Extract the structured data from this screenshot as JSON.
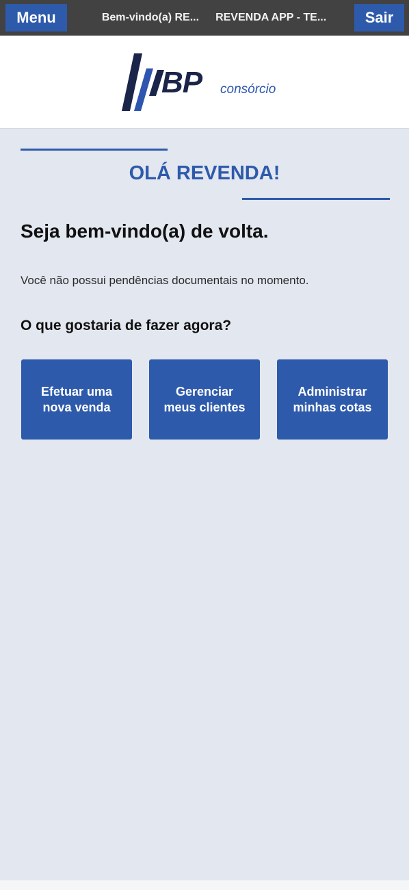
{
  "topbar": {
    "menu_label": "Menu",
    "title_1": "Bem-vindo(a) RE...",
    "title_2": "REVENDA APP - TE...",
    "logout_label": "Sair"
  },
  "header": {
    "logo_text": "BP",
    "logo_subtext": "consórcio"
  },
  "main": {
    "greeting": "OLÁ REVENDA!",
    "welcome": "Seja bem-vindo(a) de volta.",
    "pending_notice": "Você não possui pendências documentais no momento.",
    "question": "O que gostaria de fazer agora?",
    "actions": [
      {
        "label": "Efetuar uma nova venda"
      },
      {
        "label": "Gerenciar meus clientes"
      },
      {
        "label": "Administrar minhas cotas"
      }
    ]
  },
  "colors": {
    "primary": "#2e5aab",
    "topbar": "#424242",
    "background": "#e3e7ef",
    "logo_dark": "#1b2449"
  }
}
